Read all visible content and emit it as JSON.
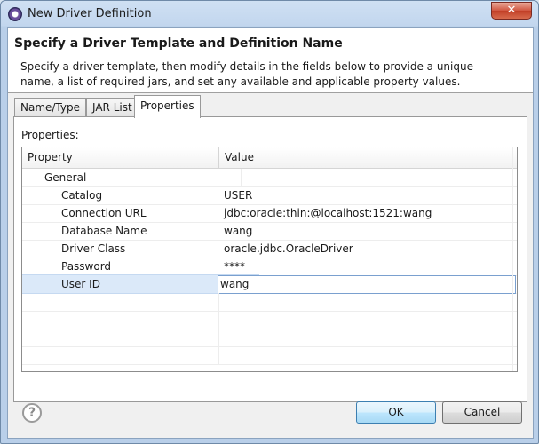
{
  "window": {
    "title": "New Driver Definition",
    "close_label": "✕"
  },
  "header": {
    "title": "Specify a Driver Template and Definition Name",
    "description": "Specify a driver template, then modify details in the fields below to provide a unique name, a list of required jars, and set any available and applicable property values."
  },
  "tabs": [
    {
      "label": "Name/Type",
      "active": false
    },
    {
      "label": "JAR List",
      "active": false
    },
    {
      "label": "Properties",
      "active": true
    }
  ],
  "properties": {
    "label": "Properties:",
    "columns": [
      "Property",
      "Value"
    ],
    "group": "General",
    "rows": [
      {
        "name": "Catalog",
        "value": "USER"
      },
      {
        "name": "Connection URL",
        "value": "jdbc:oracle:thin:@localhost:1521:wang"
      },
      {
        "name": "Database Name",
        "value": "wang"
      },
      {
        "name": "Driver Class",
        "value": "oracle.jdbc.OracleDriver"
      },
      {
        "name": "Password",
        "value": "****"
      },
      {
        "name": "User ID",
        "value": "wang",
        "editing": true
      }
    ]
  },
  "footer": {
    "help_icon": "question-icon",
    "help_glyph": "?",
    "ok_label": "OK",
    "cancel_label": "Cancel"
  }
}
